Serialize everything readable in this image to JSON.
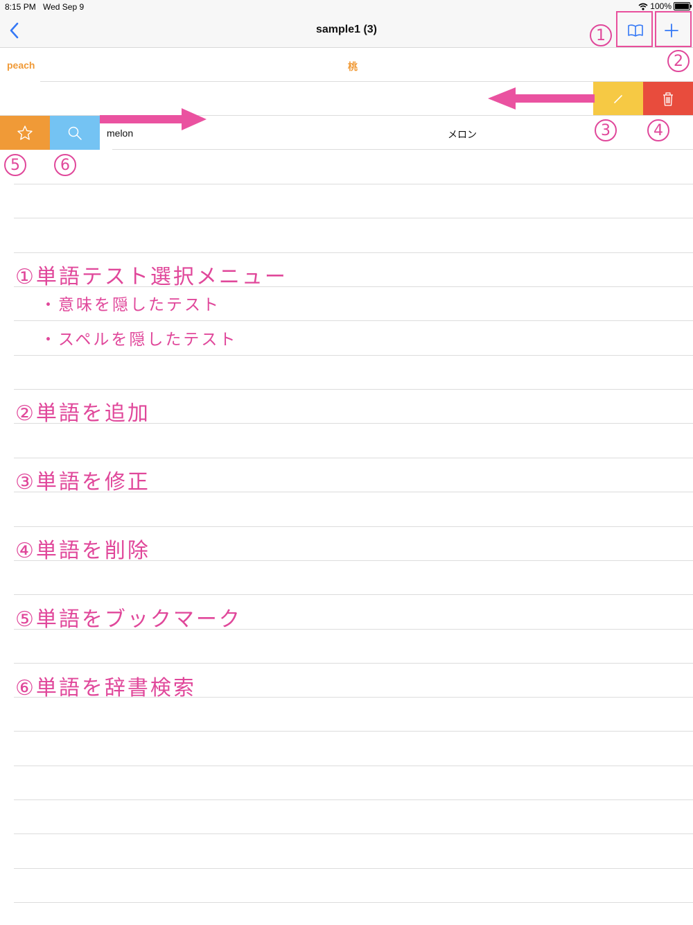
{
  "status_bar": {
    "time": "8:15 PM",
    "date": "Wed Sep 9",
    "battery": "100%",
    "battery_level": 1.0,
    "wifi_icon": "wifi-icon"
  },
  "nav": {
    "title": "sample1 (3)",
    "back_icon": "chevron-left-icon",
    "book_icon": "book-icon",
    "add_icon": "plus-icon",
    "tint": "#3478f6"
  },
  "words": [
    {
      "word": "peach",
      "meaning": "桃",
      "color": "#f09a37",
      "highlighted": true
    },
    {
      "word": "",
      "meaning": "",
      "swiped": "left"
    },
    {
      "word": "melon",
      "meaning": "メロン",
      "swiped": "right"
    }
  ],
  "swipe_actions": {
    "trailing": [
      {
        "name": "edit",
        "icon": "pencil-icon",
        "color": "#f6c944"
      },
      {
        "name": "delete",
        "icon": "trash-icon",
        "color": "#e84c3d"
      }
    ],
    "leading": [
      {
        "name": "bookmark",
        "icon": "star-icon",
        "color": "#f09a37"
      },
      {
        "name": "dictionary",
        "icon": "search-icon",
        "color": "#74c3f3"
      }
    ]
  },
  "annotations": {
    "color": "#e0479a",
    "markers": [
      "1",
      "2",
      "3",
      "4",
      "5",
      "6"
    ],
    "items": [
      {
        "text": "①単語テスト選択メニュー",
        "sub": [
          "・意味を隠したテスト",
          "・スペルを隠したテスト"
        ]
      },
      {
        "text": "②単語を追加"
      },
      {
        "text": "③単語を修正"
      },
      {
        "text": "④単語を削除"
      },
      {
        "text": "⑤単語をブックマーク"
      },
      {
        "text": "⑥単語を辞書検索"
      }
    ]
  }
}
